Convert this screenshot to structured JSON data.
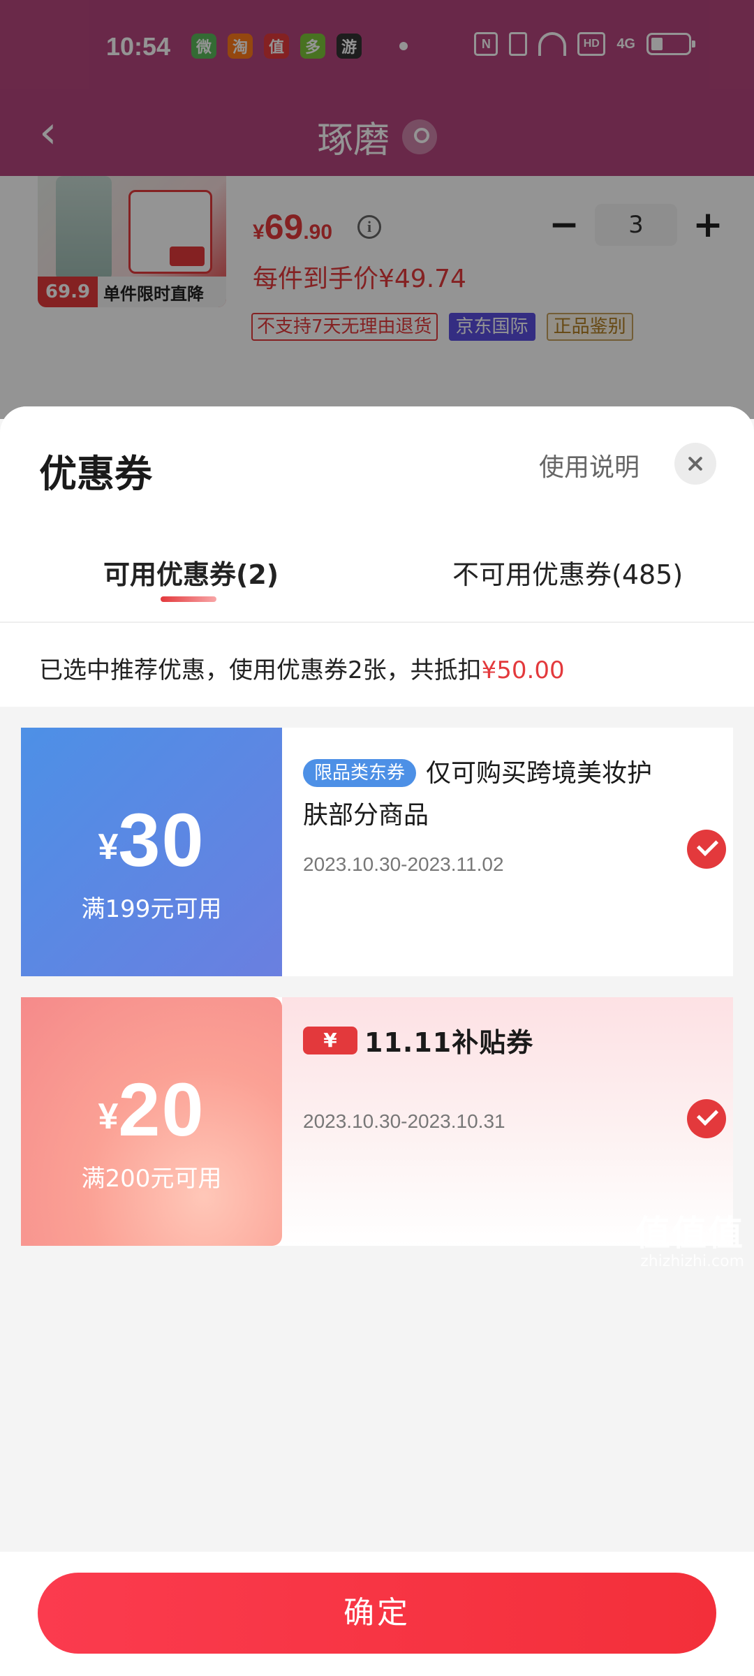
{
  "status_bar": {
    "time": "10:54",
    "apps": [
      "微",
      "淘",
      "值",
      "多",
      "游"
    ],
    "network": "4G",
    "hd": "HD",
    "nfc": "N"
  },
  "nav": {
    "back_icon": "chevron-left-icon",
    "title": "琢磨"
  },
  "product": {
    "image_badge": "69.9",
    "image_banner": "单件限时直降",
    "price": {
      "yen": "¥",
      "int": "69",
      "dec": ".90"
    },
    "info_icon": "i",
    "quantity": "3",
    "minus": "−",
    "plus": "+",
    "per_item_price": "每件到手价¥49.74",
    "tags": [
      "不支持7天无理由退货",
      "京东国际",
      "正品鉴别"
    ]
  },
  "sheet": {
    "title": "优惠券",
    "usage_link": "使用说明",
    "tabs": {
      "available": "可用优惠券(2)",
      "unavailable": "不可用优惠券(485)"
    },
    "summary_prefix": "已选中推荐优惠，使用优惠券2张，共抵扣",
    "summary_amount": "¥50.00"
  },
  "coupons": [
    {
      "currency": "¥",
      "amount": "30",
      "threshold": "满199元可用",
      "badge": "限品类东券",
      "description": "仅可购买跨境美妆护肤部分商品",
      "date_range": "2023.10.30-2023.11.02",
      "selected": true
    },
    {
      "currency": "¥",
      "amount": "20",
      "threshold": "满200元可用",
      "logo_symbol": "¥",
      "logo_text": "11.11补贴券",
      "date_range": "2023.10.30-2023.10.31",
      "selected": true
    }
  ],
  "confirm_label": "确定",
  "watermark": {
    "main": "值值值",
    "url": "zhizhizhi.com"
  },
  "colors": {
    "accent_red": "#e3393c",
    "header_purple": "#b6467e",
    "coupon_blue": "#4d90e6",
    "coupon_pink": "#f58a8a"
  }
}
